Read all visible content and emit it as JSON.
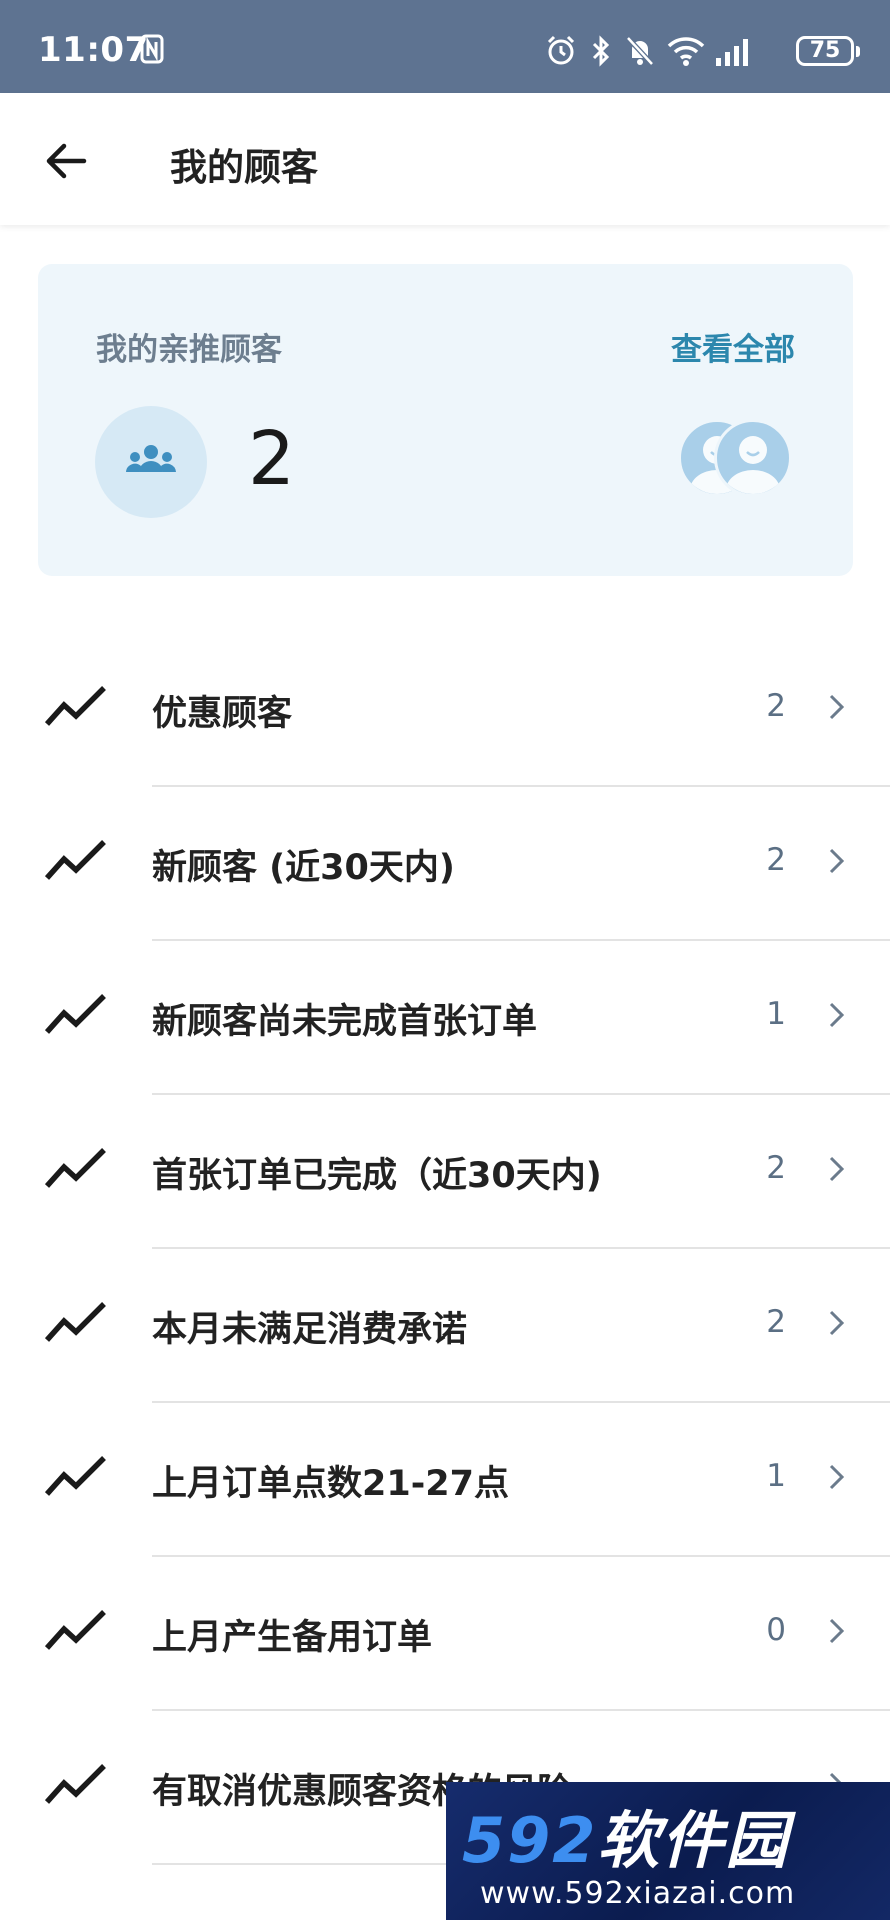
{
  "status_bar": {
    "time": "11:07",
    "battery": "75",
    "icons": [
      "nfc-icon",
      "alarm-icon",
      "bluetooth-icon",
      "mute-icon",
      "wifi-icon",
      "signal-icon",
      "battery-icon"
    ]
  },
  "header": {
    "title": "我的顾客",
    "back_icon": "arrow-left-icon"
  },
  "summary": {
    "label": "我的亲推顾客",
    "view_all": "查看全部",
    "count": "2",
    "icon": "people-group-icon",
    "avatars": [
      "avatar-icon",
      "avatar-icon"
    ],
    "accent_color": "#2c87ad",
    "card_color": "#eef6fb"
  },
  "list": {
    "items": [
      {
        "label": "优惠顾客",
        "count": "2"
      },
      {
        "label": "新顾客 (近30天内)",
        "count": "2"
      },
      {
        "label": "新顾客尚未完成首张订单",
        "count": "1"
      },
      {
        "label": "首张订单已完成（近30天内)",
        "count": "2"
      },
      {
        "label": "本月未满足消费承诺",
        "count": "2"
      },
      {
        "label": "上月订单点数21-27点",
        "count": "1"
      },
      {
        "label": "上月产生备用订单",
        "count": "0"
      },
      {
        "label": "有取消优惠顾客资格的风险",
        "count": ""
      }
    ],
    "item_icon": "trend-line-icon",
    "trailing_icon": "chevron-right-icon"
  },
  "watermark": {
    "logo_number": "592",
    "logo_text": "软件园",
    "url": "www.592xiazai.com"
  }
}
